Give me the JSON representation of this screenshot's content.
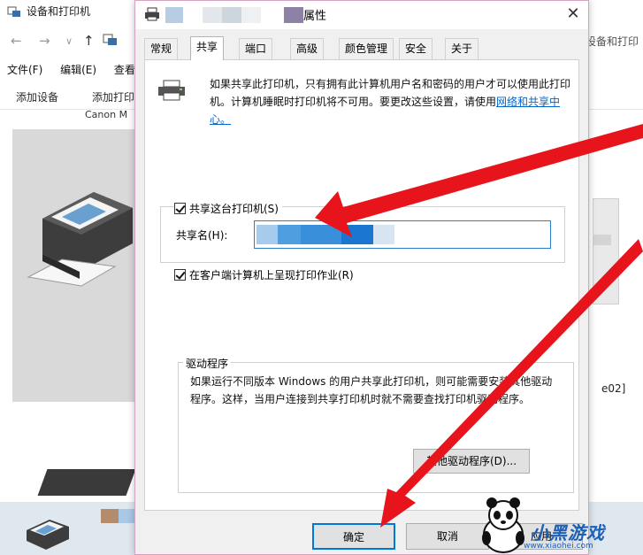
{
  "background_window": {
    "title": "设备和打印机",
    "address_tail": "设备和打印",
    "menu": [
      "文件(F)",
      "编辑(E)",
      "查看"
    ],
    "toolbar": [
      "添加设备",
      "添加打印"
    ],
    "device_label": "Canon M",
    "right_label": "e02]"
  },
  "dialog": {
    "title_suffix": "属性",
    "tabs": [
      "常规",
      "共享",
      "端口",
      "高级",
      "颜色管理",
      "安全",
      "关于"
    ],
    "active_tab": "共享",
    "info_text": "如果共享此打印机，只有拥有此计算机用户名和密码的用户才可以使用此打印机。计算机睡眠时打印机将不可用。要更改这些设置，请使用",
    "info_link": "网络和共享中心。",
    "share_checkbox_label": "共享这台打印机(S)",
    "share_checked": true,
    "share_name_label": "共享名(H):",
    "render_jobs_label": "在客户端计算机上呈现打印作业(R)",
    "render_jobs_checked": true,
    "drivers_title": "驱动程序",
    "drivers_text": "如果运行不同版本 Windows 的用户共享此打印机，则可能需要安装其他驱动程序。这样，当用户连接到共享打印机时就不需要查找打印机驱动程序。",
    "other_drivers_button": "其他驱动程序(D)...",
    "ok_button": "确定",
    "cancel_button": "取消",
    "apply_button": "应用"
  },
  "watermark": {
    "text": "小黑游戏",
    "url": "www.xiaohei.com"
  },
  "colors": {
    "accent": "#0078d7",
    "link": "#0066cc",
    "arrow": "#e8141c"
  }
}
